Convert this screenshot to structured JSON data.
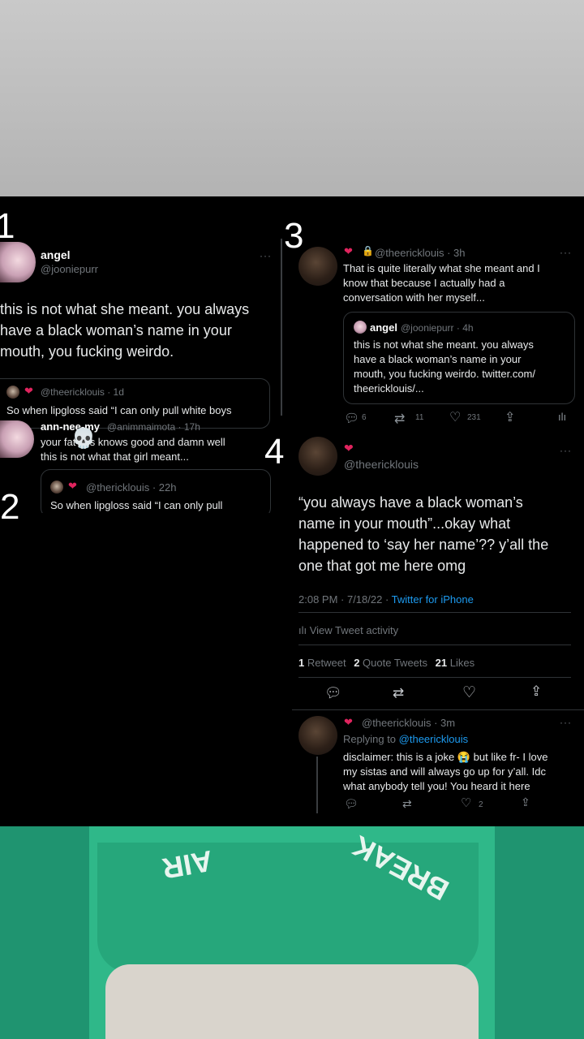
{
  "panel1": {
    "number": "1",
    "name": "angel",
    "handle": "@jooniepurr",
    "more": "···",
    "text_lines": [
      "this is not what she meant. you always",
      "have a black woman’s name in your",
      "mouth, you fucking weirdo."
    ],
    "quote_handle": "@theericklouis · 1d",
    "quote_text": "So when lipgloss said “I can only pull white boys",
    "reply_name": "ann-nee-my",
    "reply_handle": "@animmaimota · 17h",
    "reply_lines": [
      "your fat ass knows good and damn well",
      "this is not what that girl meant..."
    ]
  },
  "panel2": {
    "number": "2",
    "quote_handle": "@thericklouis · 22h",
    "quote_text": "So when lipgloss said “I can only pull"
  },
  "panel3": {
    "number": "3",
    "handle": "@theericklouis · 3h",
    "more": "···",
    "text_lines": [
      "That is quite literally what she meant and I",
      "know that because I actually had a",
      "conversation with her myself..."
    ],
    "quote_name": "angel",
    "quote_handle": "@jooniepurr · 4h",
    "quote_lines": [
      "this is not what she meant. you always",
      "have a black woman’s name in your",
      "mouth, you fucking weirdo. twitter.com/",
      "theericklouis/..."
    ],
    "replies": "6",
    "retweets": "11",
    "likes": "231"
  },
  "panel4": {
    "number": "4",
    "handle": "@theericklouis",
    "more": "···",
    "text_lines": [
      "“you always have a black woman’s",
      "name in your mouth”...okay what",
      "happened to ‘say her name’?? y’all the",
      "one that got me here omg"
    ],
    "time": "2:08 PM · 7/18/22 · ",
    "client": "Twitter for iPhone",
    "activity": "View Tweet activity",
    "retweets_count": "1",
    "retweets_label": "Retweet",
    "quotes_count": "2",
    "quotes_label": "Quote Tweets",
    "likes_count": "21",
    "likes_label": "Likes"
  },
  "panel5": {
    "handle": "@theericklouis · 3m",
    "more": "···",
    "replying_prefix": "Replying to ",
    "replying_to": "@theericklouis",
    "text_lines": [
      "disclaimer: this is a joke 😭 but like fr- I love",
      "my sistas and will always go up for y’all. Idc",
      "what anybody tell you! You heard it here"
    ],
    "likes": "2"
  },
  "shirt_text_left": "AIR",
  "shirt_text_right": "BREAK",
  "colors": {
    "link": "#1d9bf0",
    "heart": "#e0245e",
    "shirt": "#2fb889"
  }
}
